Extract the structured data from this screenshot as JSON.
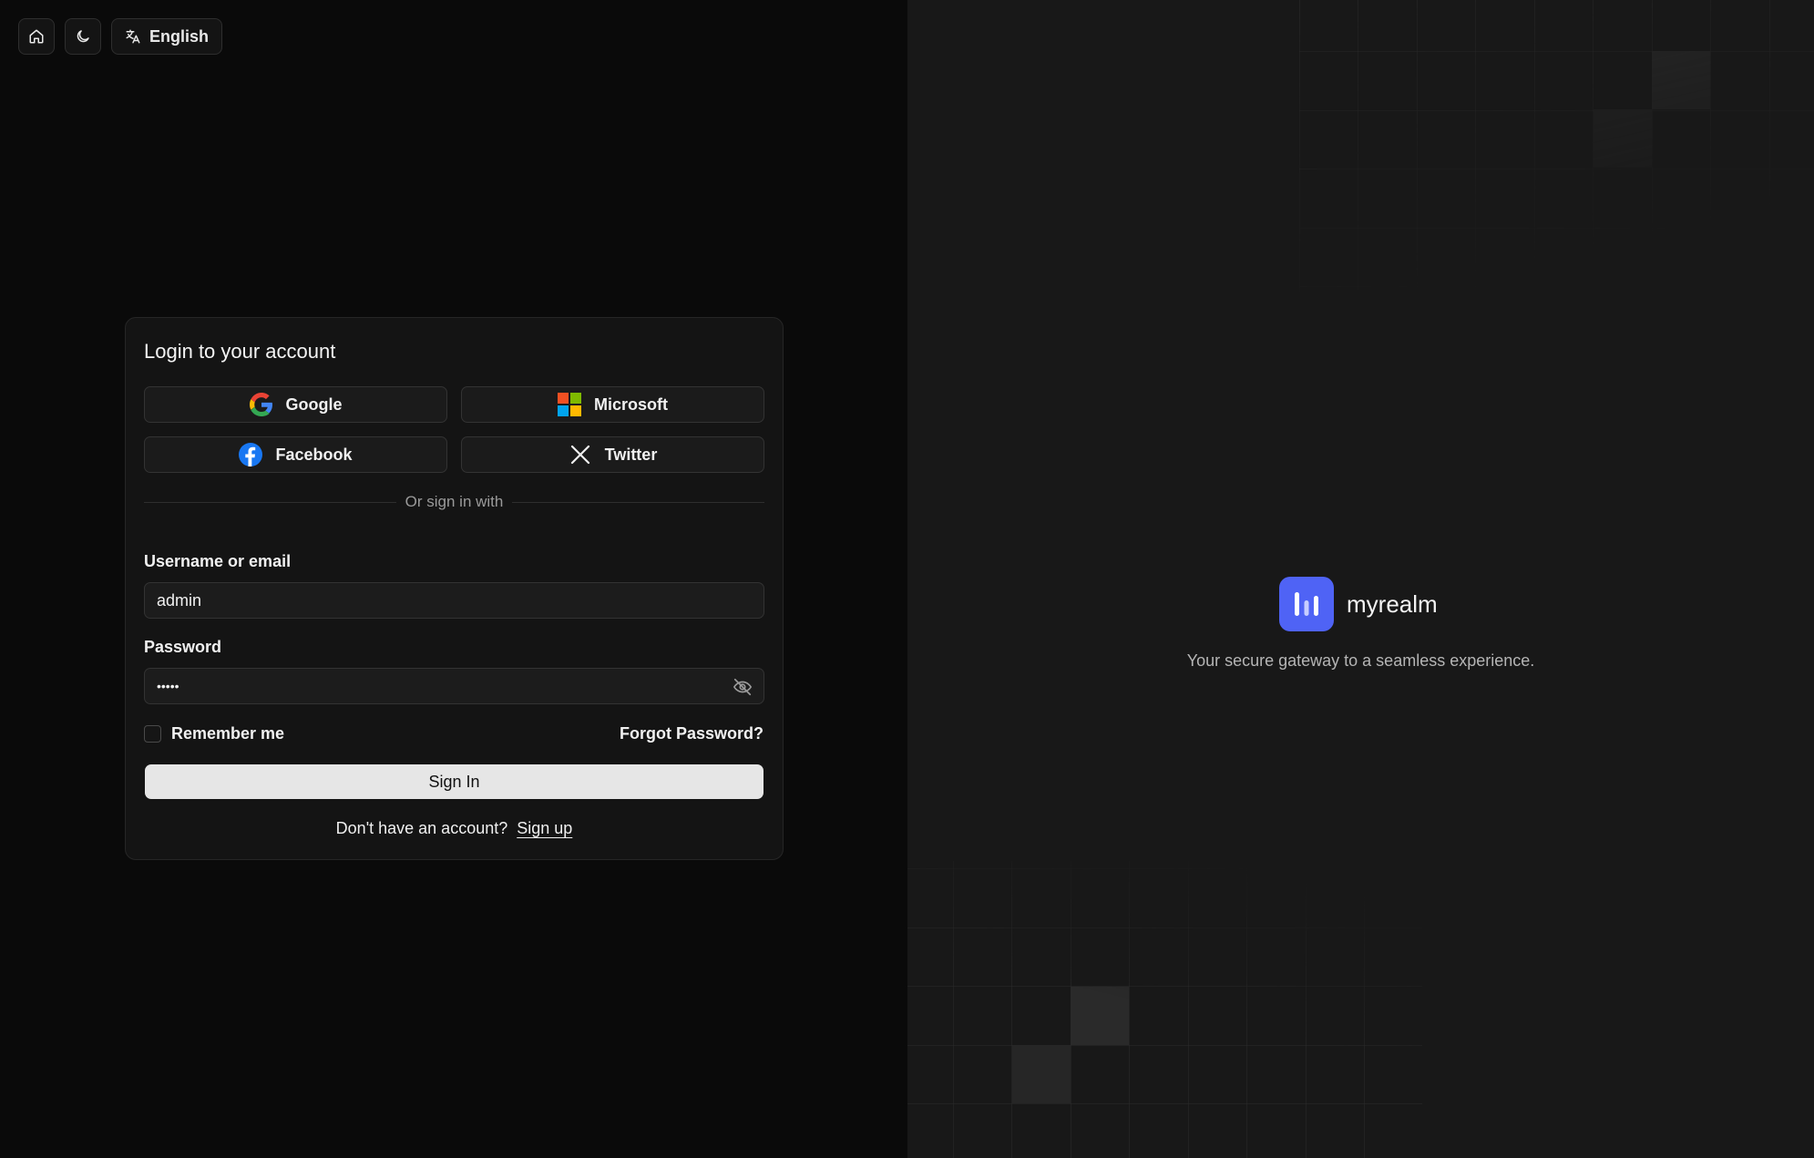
{
  "topbar": {
    "home_icon": "home-icon",
    "theme_icon": "moon-icon",
    "language_icon": "translate-icon",
    "language_label": "English"
  },
  "login": {
    "title": "Login to your account",
    "providers": [
      {
        "label": "Google",
        "icon": "google-icon"
      },
      {
        "label": "Microsoft",
        "icon": "microsoft-icon"
      },
      {
        "label": "Facebook",
        "icon": "facebook-icon"
      },
      {
        "label": "Twitter",
        "icon": "x-twitter-icon"
      }
    ],
    "divider_text": "Or sign in with",
    "username_label": "Username or email",
    "username_value": "admin",
    "password_label": "Password",
    "password_value": "•••••",
    "remember_label": "Remember me",
    "remember_checked": false,
    "forgot_label": "Forgot Password?",
    "submit_label": "Sign In",
    "signup_prompt": "Don't have an account?",
    "signup_link": "Sign up"
  },
  "brand": {
    "name": "myrealm",
    "tagline": "Your secure gateway to a seamless experience.",
    "accent_color": "#4f63f5"
  }
}
